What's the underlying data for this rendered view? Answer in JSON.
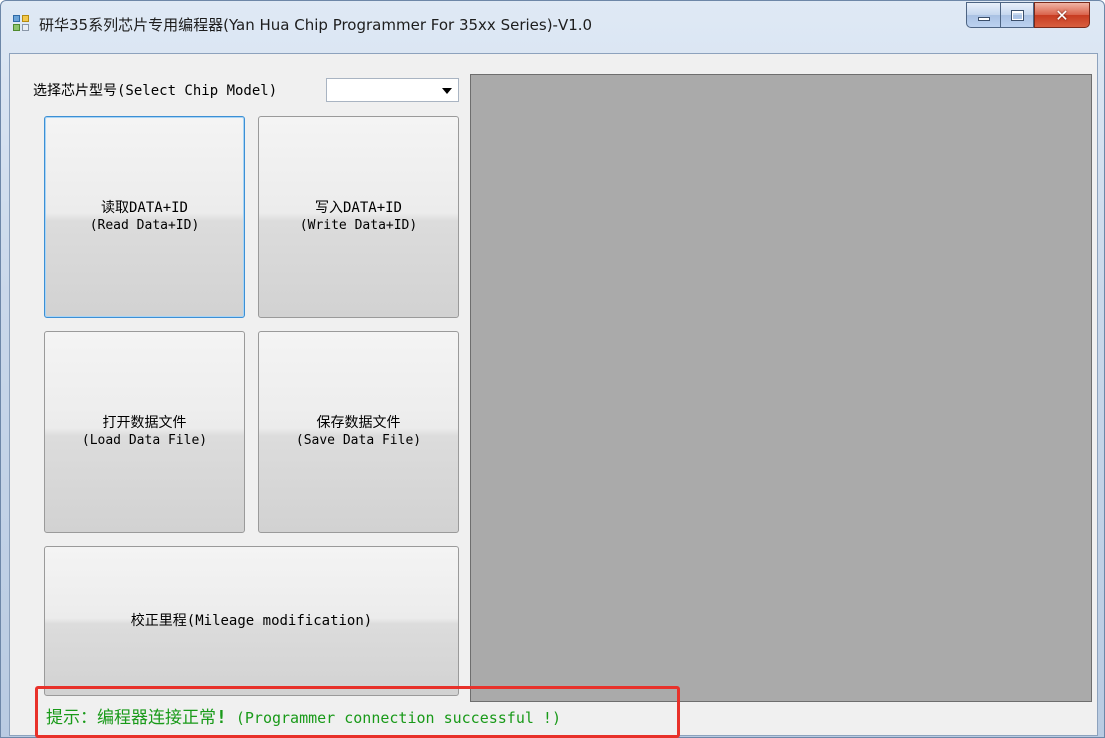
{
  "window": {
    "title": "研华35系列芯片专用编程器(Yan Hua Chip Programmer For 35xx Series)-V1.0",
    "caption": {
      "minimize": "–",
      "maximize": "□",
      "close": "✕"
    }
  },
  "chip": {
    "label": "选择芯片型号(Select Chip Model)",
    "selected": ""
  },
  "buttons": {
    "read": {
      "line1": "读取DATA+ID",
      "line2": "(Read Data+ID)"
    },
    "write": {
      "line1": "写入DATA+ID",
      "line2": "(Write Data+ID)"
    },
    "load": {
      "line1": "打开数据文件",
      "line2": "(Load Data File)"
    },
    "save": {
      "line1": "保存数据文件",
      "line2": "(Save Data File)"
    },
    "mileage": {
      "label": "校正里程(Mileage modification)"
    }
  },
  "status": {
    "prefix": "提示：编程器连接正常",
    "bang": "!",
    "english": " (Programmer connection successful !)"
  },
  "colors": {
    "status_text": "#199a19",
    "status_highlight": "#e8312a",
    "display_panel": "#aaaaaa"
  },
  "icons": {
    "app": "app-window-icon",
    "dropdown": "chevron-down-icon"
  }
}
